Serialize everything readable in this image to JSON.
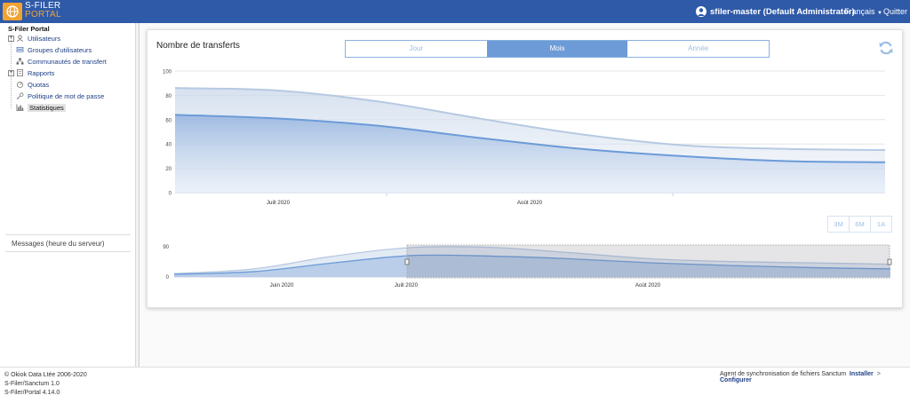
{
  "header": {
    "brand_line1": "S-FILER",
    "brand_line2": "PORTAL",
    "user": "sfiler-master (Default Administrator)",
    "language": "Français",
    "quit": "Quitter"
  },
  "sidebar": {
    "root": "S-Filer Portal",
    "items": [
      {
        "label": "Utilisateurs",
        "icon": "user-icon",
        "expandable": true
      },
      {
        "label": "Groupes d'utilisateurs",
        "icon": "group-icon",
        "expandable": false
      },
      {
        "label": "Communautés de transfert",
        "icon": "community-icon",
        "expandable": false
      },
      {
        "label": "Rapports",
        "icon": "report-icon",
        "expandable": true
      },
      {
        "label": "Quotas",
        "icon": "quota-icon",
        "expandable": false
      },
      {
        "label": "Politique de mot de passe",
        "icon": "key-icon",
        "expandable": false
      },
      {
        "label": "Statistiques",
        "icon": "stats-icon",
        "expandable": false,
        "active": true
      }
    ],
    "messages": "Messages (heure du serveur)"
  },
  "main": {
    "title": "Nombre de transferts",
    "tabs": [
      "Jour",
      "Mois",
      "Année"
    ],
    "active_tab": "Mois",
    "range_buttons": [
      "3M",
      "6M",
      "1A"
    ]
  },
  "chart_data": [
    {
      "type": "area",
      "title": "Nombre de transferts",
      "x_tick_labels": [
        "Juill 2020",
        "Août 2020"
      ],
      "y_ticks": [
        0,
        20,
        40,
        60,
        80,
        100
      ],
      "ylim": [
        0,
        100
      ],
      "grid": true,
      "series": [
        {
          "values": [
            86,
            84,
            75,
            61,
            48,
            39,
            36,
            35
          ],
          "color": "#b7c9e2"
        },
        {
          "values": [
            64,
            61,
            55,
            45,
            36,
            30,
            26,
            25
          ],
          "color": "#6c9bd8"
        }
      ]
    },
    {
      "type": "area",
      "x_tick_labels": [
        "Juin 2020",
        "Juill 2020",
        "Août 2020"
      ],
      "y_ticks": [
        0,
        90
      ],
      "ylim": [
        0,
        90
      ],
      "series": [
        {
          "values": [
            10,
            24,
            62,
            88,
            88,
            72,
            54,
            46,
            42,
            38
          ],
          "color": "#b7c9e2"
        },
        {
          "values": [
            8,
            16,
            42,
            64,
            62,
            54,
            42,
            34,
            28,
            24
          ],
          "color": "#6c9bd8"
        }
      ],
      "selection": {
        "from": "Juill 2020",
        "to": "end"
      }
    }
  ],
  "footer": {
    "copyright": "© Okiok Data Ltée 2006-2020",
    "v1": "S-Filer/Sanctum 1.0",
    "v2": "S-Filer/Portal 4.14.0",
    "agent": "Agent de synchronisation de fichiers Sanctum",
    "install": "Installer",
    "sep": ">",
    "configure": "Configurer"
  }
}
